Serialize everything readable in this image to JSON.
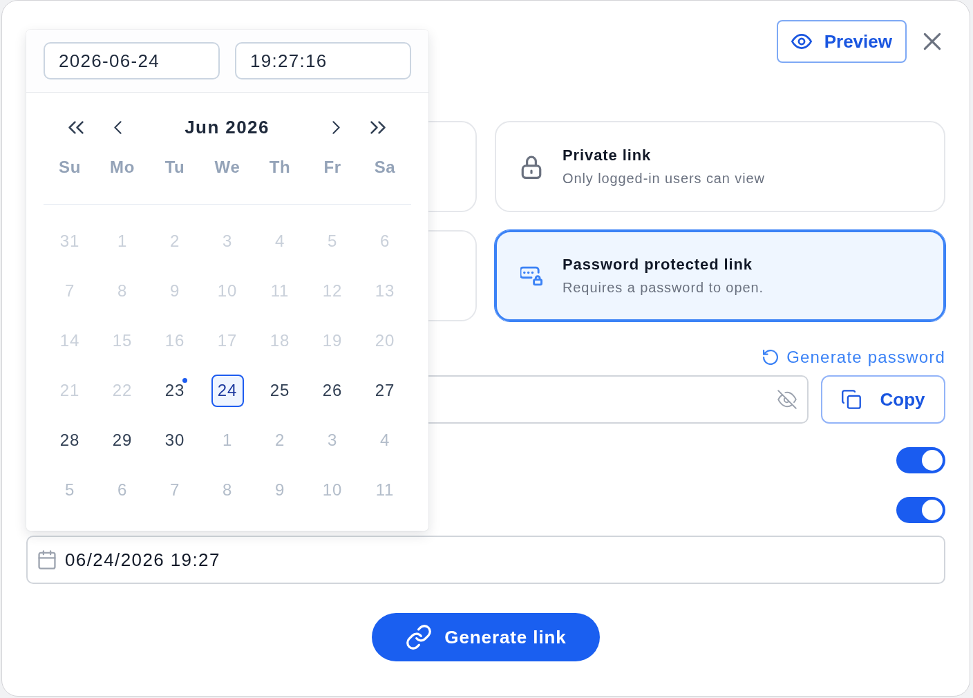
{
  "header": {
    "preview_button": "Preview"
  },
  "link_options": [
    {
      "kind": "private",
      "title": "Private link",
      "description": "Only logged-in users can view",
      "selected": false
    },
    {
      "kind": "password",
      "title": "Password protected link",
      "description": "Requires a password to open.",
      "selected": true
    }
  ],
  "password": {
    "generate_link": "Generate password",
    "copy_button": "Copy"
  },
  "toggles": [
    {
      "on": true
    },
    {
      "on": true
    }
  ],
  "expiry": {
    "value": "06/24/2026 19:27"
  },
  "generate_button": "Generate link",
  "date_picker": {
    "date_input": "2026-06-24",
    "time_input": "19:27:16",
    "month_title": "Jun 2026",
    "weekdays": [
      "Su",
      "Mo",
      "Tu",
      "We",
      "Th",
      "Fr",
      "Sa"
    ],
    "days": [
      {
        "label": "31",
        "kind": "disabled",
        "selected": false,
        "today": false
      },
      {
        "label": "1",
        "kind": "disabled",
        "selected": false,
        "today": false
      },
      {
        "label": "2",
        "kind": "disabled",
        "selected": false,
        "today": false
      },
      {
        "label": "3",
        "kind": "disabled",
        "selected": false,
        "today": false
      },
      {
        "label": "4",
        "kind": "disabled",
        "selected": false,
        "today": false
      },
      {
        "label": "5",
        "kind": "disabled",
        "selected": false,
        "today": false
      },
      {
        "label": "6",
        "kind": "disabled",
        "selected": false,
        "today": false
      },
      {
        "label": "7",
        "kind": "disabled",
        "selected": false,
        "today": false
      },
      {
        "label": "8",
        "kind": "disabled",
        "selected": false,
        "today": false
      },
      {
        "label": "9",
        "kind": "disabled",
        "selected": false,
        "today": false
      },
      {
        "label": "10",
        "kind": "disabled",
        "selected": false,
        "today": false
      },
      {
        "label": "11",
        "kind": "disabled",
        "selected": false,
        "today": false
      },
      {
        "label": "12",
        "kind": "disabled",
        "selected": false,
        "today": false
      },
      {
        "label": "13",
        "kind": "disabled",
        "selected": false,
        "today": false
      },
      {
        "label": "14",
        "kind": "disabled",
        "selected": false,
        "today": false
      },
      {
        "label": "15",
        "kind": "disabled",
        "selected": false,
        "today": false
      },
      {
        "label": "16",
        "kind": "disabled",
        "selected": false,
        "today": false
      },
      {
        "label": "17",
        "kind": "disabled",
        "selected": false,
        "today": false
      },
      {
        "label": "18",
        "kind": "disabled",
        "selected": false,
        "today": false
      },
      {
        "label": "19",
        "kind": "disabled",
        "selected": false,
        "today": false
      },
      {
        "label": "20",
        "kind": "disabled",
        "selected": false,
        "today": false
      },
      {
        "label": "21",
        "kind": "disabled",
        "selected": false,
        "today": false
      },
      {
        "label": "22",
        "kind": "disabled",
        "selected": false,
        "today": false
      },
      {
        "label": "23",
        "kind": "current",
        "selected": false,
        "today": true
      },
      {
        "label": "24",
        "kind": "current",
        "selected": true,
        "today": false
      },
      {
        "label": "25",
        "kind": "current",
        "selected": false,
        "today": false
      },
      {
        "label": "26",
        "kind": "current",
        "selected": false,
        "today": false
      },
      {
        "label": "27",
        "kind": "current",
        "selected": false,
        "today": false
      },
      {
        "label": "28",
        "kind": "current",
        "selected": false,
        "today": false
      },
      {
        "label": "29",
        "kind": "current",
        "selected": false,
        "today": false
      },
      {
        "label": "30",
        "kind": "current",
        "selected": false,
        "today": false
      },
      {
        "label": "1",
        "kind": "next",
        "selected": false,
        "today": false
      },
      {
        "label": "2",
        "kind": "next",
        "selected": false,
        "today": false
      },
      {
        "label": "3",
        "kind": "next",
        "selected": false,
        "today": false
      },
      {
        "label": "4",
        "kind": "next",
        "selected": false,
        "today": false
      },
      {
        "label": "5",
        "kind": "next",
        "selected": false,
        "today": false
      },
      {
        "label": "6",
        "kind": "next",
        "selected": false,
        "today": false
      },
      {
        "label": "7",
        "kind": "next",
        "selected": false,
        "today": false
      },
      {
        "label": "8",
        "kind": "next",
        "selected": false,
        "today": false
      },
      {
        "label": "9",
        "kind": "next",
        "selected": false,
        "today": false
      },
      {
        "label": "10",
        "kind": "next",
        "selected": false,
        "today": false
      },
      {
        "label": "11",
        "kind": "next",
        "selected": false,
        "today": false
      }
    ]
  }
}
